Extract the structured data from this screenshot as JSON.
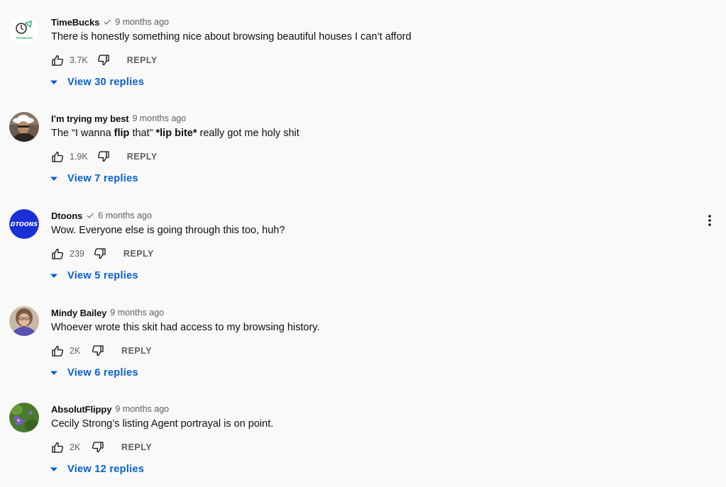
{
  "comments": [
    {
      "author": "TimeBucks",
      "verified": true,
      "time": "9 months ago",
      "text_parts": [
        "There is honestly something nice about browsing beautiful houses I can’t afford"
      ],
      "likes": "3.7K",
      "reply_label": "REPLY",
      "view_replies": "View 30 replies",
      "avatar_icon": "timebucks-logo-avatar",
      "avatar_text": "TimeBucks"
    },
    {
      "author": "I’m trying my best",
      "verified": false,
      "time": "9 months ago",
      "text_parts": [
        "The “I wanna ",
        "flip",
        " that” ",
        "*lip bite*",
        " really got me holy shit"
      ],
      "likes": "1.9K",
      "reply_label": "REPLY",
      "view_replies": "View 7 replies",
      "avatar_icon": "person-photo-avatar"
    },
    {
      "author": "Dtoons",
      "verified": true,
      "time": "6 months ago",
      "text_parts": [
        "Wow. Everyone else is going through this too, huh?"
      ],
      "likes": "239",
      "reply_label": "REPLY",
      "view_replies": "View 5 replies",
      "avatar_icon": "dtoons-logo-avatar",
      "avatar_text": "DTOONS",
      "show_menu": true
    },
    {
      "author": "Mindy Bailey",
      "verified": false,
      "time": "9 months ago",
      "text_parts": [
        "Whoever wrote this skit had access to my browsing history."
      ],
      "likes": "2K",
      "reply_label": "REPLY",
      "view_replies": "View 6 replies",
      "avatar_icon": "person-photo-avatar"
    },
    {
      "author": "AbsolutFlippy",
      "verified": false,
      "time": "9 months ago",
      "text_parts": [
        "Cecily Strong’s listing Agent portrayal is on point."
      ],
      "likes": "2K",
      "reply_label": "REPLY",
      "view_replies": "View 12 replies",
      "avatar_icon": "flower-photo-avatar"
    }
  ],
  "icons": {
    "like": "thumb-up-icon",
    "dislike": "thumb-down-icon",
    "verified": "verified-check-icon",
    "expand": "caret-down-icon",
    "menu": "more-vert-icon"
  },
  "colors": {
    "background": "#f9f9f9",
    "link_blue": "#065fd4",
    "secondary_text": "#606060",
    "primary_text": "#0f0f0f",
    "dtoons_blue": "#1a2fd6",
    "timebucks_green": "#3bb273"
  }
}
